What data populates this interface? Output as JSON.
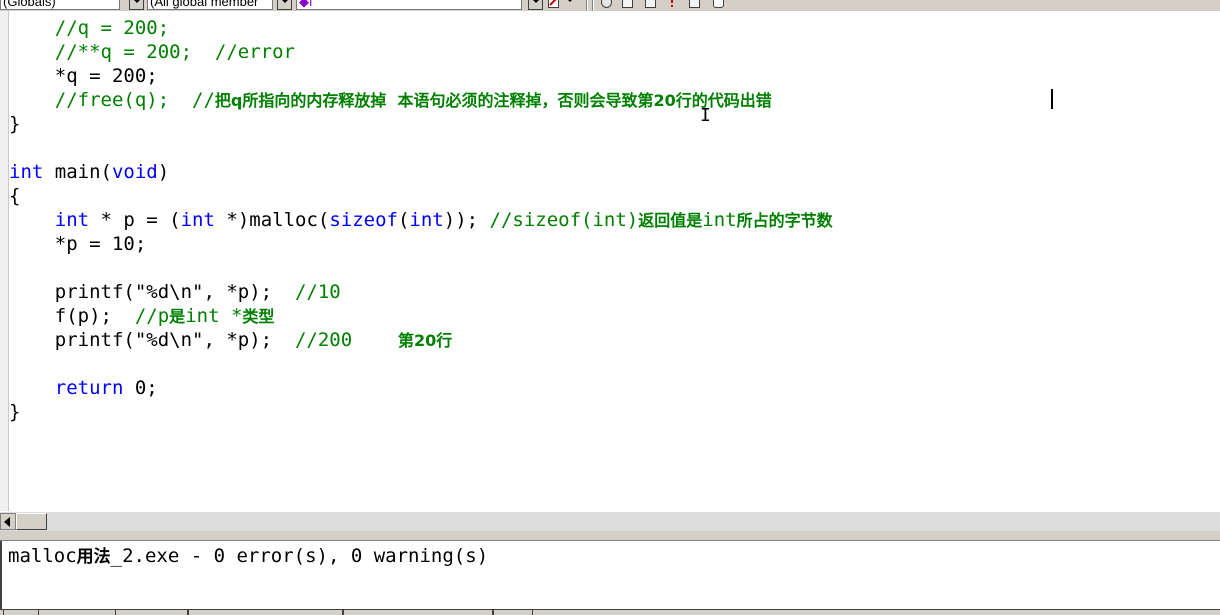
{
  "toolbar": {
    "scope_combo": "(Globals)",
    "members_combo": "(All global member",
    "function_combo": "◆f",
    "icons": [
      "wizard-action-icon",
      "go-to-definition-icon",
      "compile-icon",
      "build-icon",
      "stop-build-icon",
      "execute-icon",
      "breakpoint-icon"
    ]
  },
  "editor": {
    "lines": [
      {
        "indent": "    ",
        "segments": [
          {
            "t": "//q = 200;",
            "c": "cm"
          }
        ]
      },
      {
        "indent": "    ",
        "segments": [
          {
            "t": "//**q = 200;  //error",
            "c": "cm"
          }
        ]
      },
      {
        "indent": "    ",
        "segments": [
          {
            "t": "*q = 200;",
            "c": ""
          }
        ]
      },
      {
        "indent": "    ",
        "segments": [
          {
            "t": "//free(q);  //",
            "c": "cm"
          },
          {
            "t": "把q所指向的内存释放掉  本语句必须的注释掉，否则会导致第20行的代码出错",
            "c": "zh"
          }
        ]
      },
      {
        "indent": "",
        "segments": [
          {
            "t": "}",
            "c": ""
          }
        ]
      },
      {
        "indent": "",
        "segments": []
      },
      {
        "indent": "",
        "segments": [
          {
            "t": "int",
            "c": "kw"
          },
          {
            "t": " main(",
            "c": ""
          },
          {
            "t": "void",
            "c": "kw"
          },
          {
            "t": ")",
            "c": ""
          }
        ]
      },
      {
        "indent": "",
        "segments": [
          {
            "t": "{",
            "c": ""
          }
        ]
      },
      {
        "indent": "    ",
        "segments": [
          {
            "t": "int",
            "c": "kw"
          },
          {
            "t": " * p = (",
            "c": ""
          },
          {
            "t": "int",
            "c": "kw"
          },
          {
            "t": " *)malloc(",
            "c": ""
          },
          {
            "t": "sizeof",
            "c": "kw"
          },
          {
            "t": "(",
            "c": ""
          },
          {
            "t": "int",
            "c": "kw"
          },
          {
            "t": ")); ",
            "c": ""
          },
          {
            "t": "//sizeof(int)",
            "c": "cm"
          },
          {
            "t": "返回值是",
            "c": "zh"
          },
          {
            "t": "int",
            "c": "cm"
          },
          {
            "t": "所占的字节数",
            "c": "zh"
          }
        ]
      },
      {
        "indent": "    ",
        "segments": [
          {
            "t": "*p = 10;",
            "c": ""
          }
        ]
      },
      {
        "indent": "",
        "segments": []
      },
      {
        "indent": "    ",
        "segments": [
          {
            "t": "printf(\"%d\\n\", *p);  ",
            "c": ""
          },
          {
            "t": "//10",
            "c": "cm"
          }
        ]
      },
      {
        "indent": "    ",
        "segments": [
          {
            "t": "f(p);  ",
            "c": ""
          },
          {
            "t": "//p",
            "c": "cm"
          },
          {
            "t": "是",
            "c": "zh"
          },
          {
            "t": "int *",
            "c": "cm"
          },
          {
            "t": "类型",
            "c": "zh"
          }
        ]
      },
      {
        "indent": "    ",
        "segments": [
          {
            "t": "printf(\"%d\\n\", *p);  ",
            "c": ""
          },
          {
            "t": "//200    ",
            "c": "cm"
          },
          {
            "t": "第20行",
            "c": "zh"
          }
        ]
      },
      {
        "indent": "",
        "segments": []
      },
      {
        "indent": "    ",
        "segments": [
          {
            "t": "return",
            "c": "kw"
          },
          {
            "t": " 0;",
            "c": ""
          }
        ]
      },
      {
        "indent": "",
        "segments": [
          {
            "t": "}",
            "c": ""
          }
        ]
      }
    ]
  },
  "output": {
    "prefix": "malloc",
    "zh_part": "用法",
    "suffix": "_2.exe - 0 error(s), 0 warning(s)"
  },
  "colors": {
    "keyword": "#0000ff",
    "comment": "#008000",
    "chrome": "#d4d0c8"
  }
}
